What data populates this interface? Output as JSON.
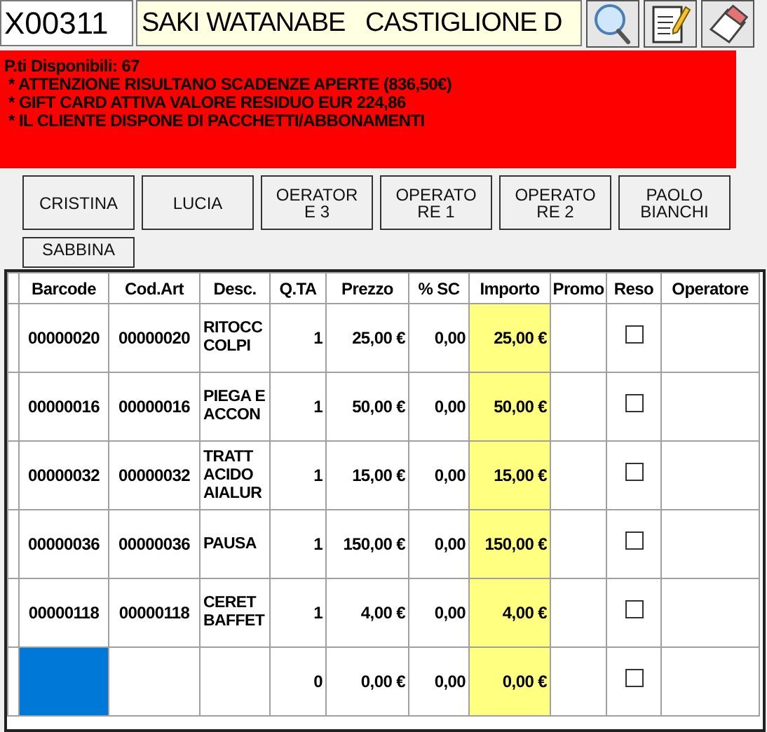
{
  "customer": {
    "code": "X00311",
    "name": "SAKI WATANABE   CASTIGLIONE D"
  },
  "toolbar": [
    {
      "kind": "search"
    },
    {
      "kind": "notes"
    },
    {
      "kind": "eraser"
    }
  ],
  "alert": {
    "points": "P.ti Disponibili: 67",
    "messages": [
      " * ATTENZIONE RISULTANO SCADENZE APERTE (836,50€)",
      " * GIFT CARD ATTIVA VALORE RESIDUO EUR 224,86",
      " * IL CLIENTE DISPONE DI PACCHETTI/ABBONAMENTI"
    ]
  },
  "operators": [
    {
      "lines": [
        "CRISTINA"
      ]
    },
    {
      "lines": [
        "LUCIA"
      ]
    },
    {
      "lines": [
        "OERATOR",
        "E 3"
      ]
    },
    {
      "lines": [
        "OPERATO",
        "RE 1"
      ]
    },
    {
      "lines": [
        "OPERATO",
        "RE 2"
      ]
    },
    {
      "lines": [
        "PAOLO",
        "BIANCHI"
      ]
    },
    {
      "lines": [
        "SABBINA"
      ]
    }
  ],
  "table": {
    "columns": [
      "Barcode",
      "Cod.Art",
      "Desc.",
      "Q.TA",
      "Prezzo",
      "% SC",
      "Importo",
      "Promo",
      "Reso",
      "Operatore"
    ],
    "rows": [
      {
        "barcode": "00000020",
        "cod_art": "00000020",
        "desc": "RITOCC COLPI",
        "qta": "1",
        "prezzo": "25,00 €",
        "sc": "0,00",
        "importo": "25,00 €",
        "reso_checked": false,
        "selected": false
      },
      {
        "barcode": "00000016",
        "cod_art": "00000016",
        "desc": "PIEGA E ACCON",
        "qta": "1",
        "prezzo": "50,00 €",
        "sc": "0,00",
        "importo": "50,00 €",
        "reso_checked": false,
        "selected": false
      },
      {
        "barcode": "00000032",
        "cod_art": "00000032",
        "desc": "TRATT ACIDO AIALUR",
        "qta": "1",
        "prezzo": "15,00 €",
        "sc": "0,00",
        "importo": "15,00 €",
        "reso_checked": false,
        "selected": false
      },
      {
        "barcode": "00000036",
        "cod_art": "00000036",
        "desc": "PAUSA",
        "qta": "1",
        "prezzo": "150,00 €",
        "sc": "0,00",
        "importo": "150,00 €",
        "reso_checked": false,
        "selected": false
      },
      {
        "barcode": "00000118",
        "cod_art": "00000118",
        "desc": "CERET BAFFET",
        "qta": "1",
        "prezzo": "4,00 €",
        "sc": "0,00",
        "importo": "4,00 €",
        "reso_checked": false,
        "selected": false
      },
      {
        "qta": "0",
        "prezzo": "0,00 €",
        "sc": "0,00",
        "importo": "0,00 €",
        "reso_checked": false,
        "selected": true
      }
    ]
  }
}
